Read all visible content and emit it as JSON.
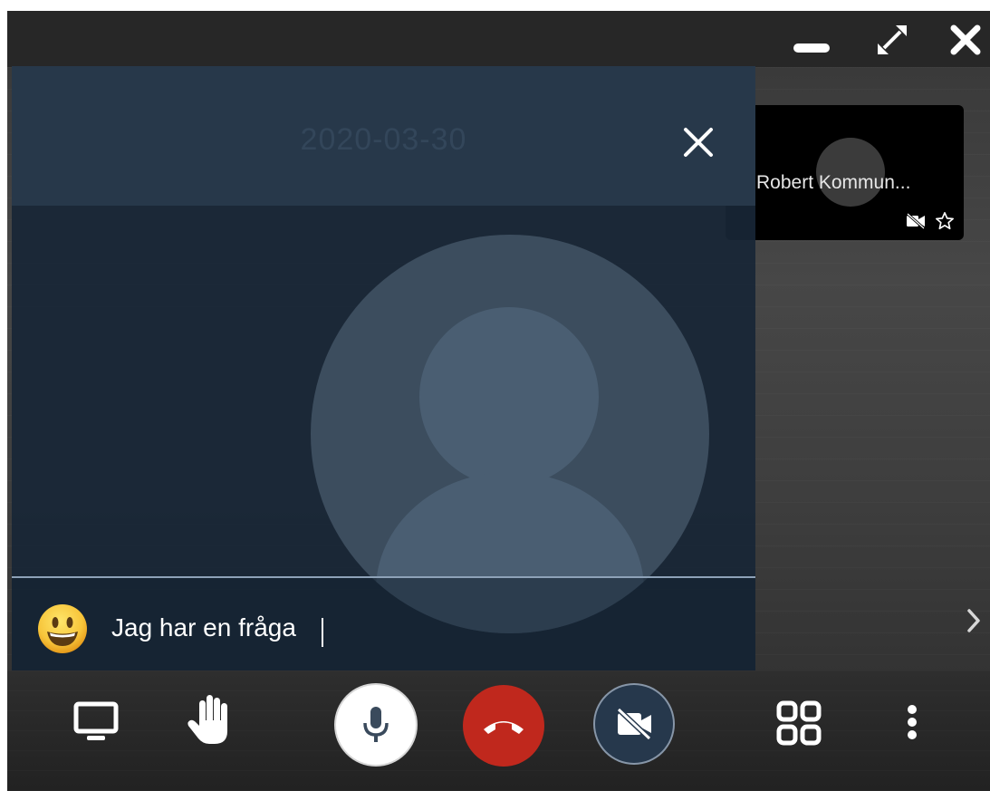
{
  "window": {
    "minimize_label": "Minimize",
    "fullscreen_label": "Fullscreen",
    "close_label": "Close"
  },
  "participant": {
    "name": "Robert Kommun..."
  },
  "chat": {
    "date": "2020-03-30",
    "message_value": "Jag har en fråga",
    "emoji_icon": "smiley-icon"
  },
  "toolbar": {
    "items": [
      "screen-share-icon",
      "raise-hand-icon",
      "microphone-icon",
      "hang-up-icon",
      "camera-off-icon",
      "tile-view-icon",
      "more-icon"
    ]
  },
  "colors": {
    "hangup": "#c0281d",
    "chat_bg": "#182636",
    "mic_bg": "#ffffff",
    "camera_bg": "#26384c"
  }
}
